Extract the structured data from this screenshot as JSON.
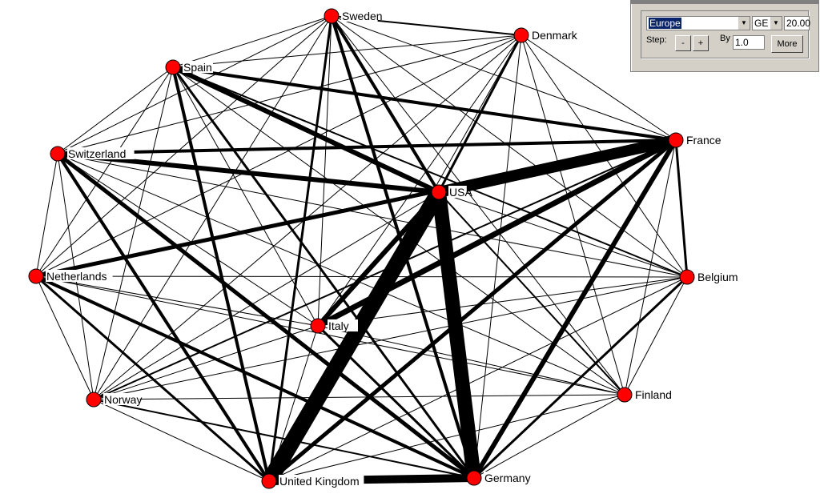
{
  "nodes": [
    {
      "id": "Sweden",
      "label": "Sweden"
    },
    {
      "id": "Denmark",
      "label": "Denmark"
    },
    {
      "id": "Spain",
      "label": "Spain"
    },
    {
      "id": "France",
      "label": "France"
    },
    {
      "id": "Switzerland",
      "label": "Switzerland"
    },
    {
      "id": "USA",
      "label": "USA"
    },
    {
      "id": "Netherlands",
      "label": "Netherlands"
    },
    {
      "id": "Belgium",
      "label": "Belgium"
    },
    {
      "id": "Italy",
      "label": "Italy"
    },
    {
      "id": "Finland",
      "label": "Finland"
    },
    {
      "id": "Norway",
      "label": "Norway"
    },
    {
      "id": "United Kingdom",
      "label": "United Kingdom"
    },
    {
      "id": "Germany",
      "label": "Germany"
    }
  ],
  "heavy_edges": [
    [
      "USA",
      "United Kingdom",
      20
    ],
    [
      "USA",
      "Germany",
      18
    ],
    [
      "USA",
      "France",
      14
    ],
    [
      "United Kingdom",
      "Germany",
      10
    ],
    [
      "Italy",
      "France",
      7
    ],
    [
      "Italy",
      "USA",
      6
    ],
    [
      "Netherlands",
      "France",
      5
    ],
    [
      "Switzerland",
      "USA",
      6
    ],
    [
      "Switzerland",
      "France",
      4
    ],
    [
      "Spain",
      "USA",
      6
    ],
    [
      "Spain",
      "France",
      4
    ],
    [
      "Sweden",
      "USA",
      4
    ],
    [
      "Sweden",
      "Germany",
      4
    ],
    [
      "Germany",
      "France",
      6
    ],
    [
      "United Kingdom",
      "France",
      5
    ],
    [
      "Switzerland",
      "Germany",
      5
    ],
    [
      "Switzerland",
      "United Kingdom",
      4
    ],
    [
      "Netherlands",
      "Germany",
      4
    ],
    [
      "Netherlands",
      "United Kingdom",
      3
    ],
    [
      "Spain",
      "United Kingdom",
      4
    ],
    [
      "Spain",
      "Germany",
      3
    ],
    [
      "Denmark",
      "USA",
      3
    ],
    [
      "Sweden",
      "United Kingdom",
      3
    ],
    [
      "Belgium",
      "Germany",
      3
    ],
    [
      "Belgium",
      "France",
      3
    ],
    [
      "Finland",
      "USA",
      2
    ],
    [
      "Sweden",
      "Denmark",
      2
    ],
    [
      "Spain",
      "Belgium",
      2
    ],
    [
      "Norway",
      "Germany",
      2
    ],
    [
      "Norway",
      "France",
      2
    ],
    [
      "Italy",
      "Germany",
      3
    ]
  ],
  "default_weight": 1,
  "node_color": "#ff0000",
  "panel": {
    "partition_value": "Europe",
    "measure_value": "GE",
    "threshold": "20.00",
    "step_label": "Step:",
    "minus_label": "-",
    "plus_label": "+",
    "by_label": "By",
    "by_value": "1.0",
    "more_label": "More"
  }
}
